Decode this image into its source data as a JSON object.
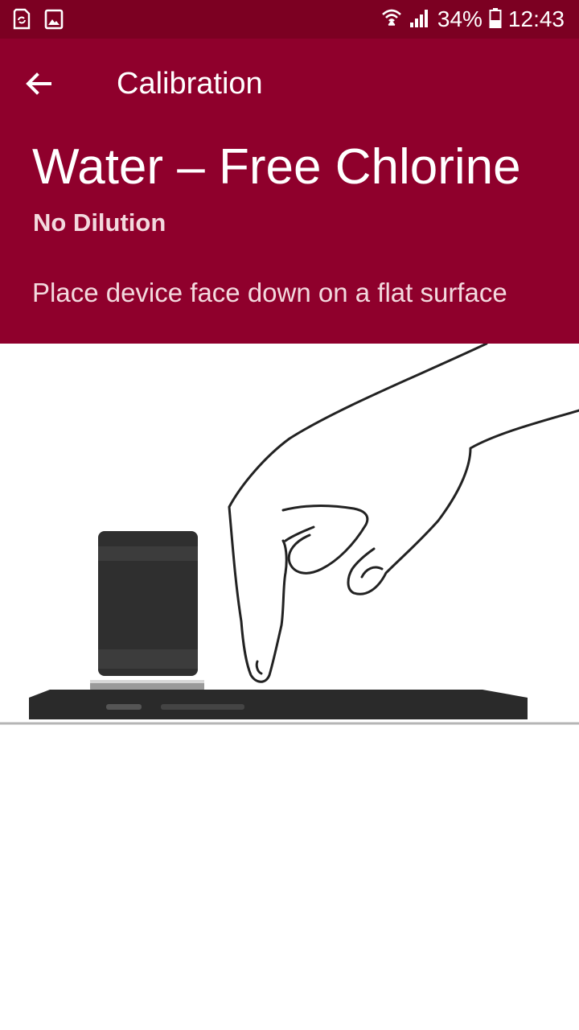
{
  "status_bar": {
    "battery": "34%",
    "time": "12:43",
    "icons": [
      "sync-doc-icon",
      "image-icon",
      "wifi-icon",
      "signal-icon",
      "battery-icon"
    ]
  },
  "toolbar": {
    "back_icon": "arrow-left-icon",
    "title": "Calibration"
  },
  "test": {
    "name": "Water – Free Chlorine",
    "dilution": "No Dilution"
  },
  "instruction": "Place device face down on a flat surface",
  "colors": {
    "status_bar": "#7c0022",
    "app_bar": "#8f002c",
    "subtext": "#f3d9de"
  }
}
